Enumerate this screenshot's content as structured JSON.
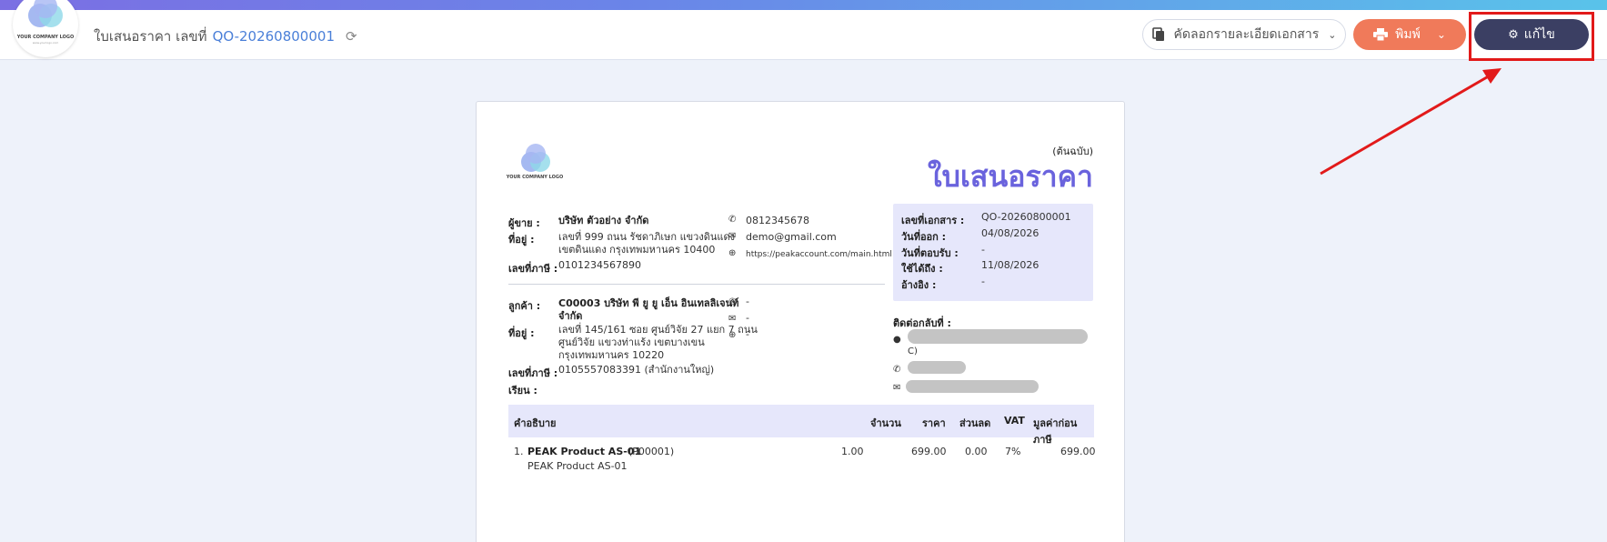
{
  "header": {
    "logo_text": "YOUR COMPANY LOGO",
    "logo_sub": "www.yourlogo.com",
    "doc_type": "ใบเสนอราคา เลขที่",
    "doc_number": "QO-20260800001",
    "copy_button": "คัดลอกรายละเอียดเอกสาร",
    "print_button": "พิมพ์",
    "edit_button": "แก้ไข"
  },
  "document": {
    "logo_text": "YOUR COMPANY LOGO",
    "original_label": "(ต้นฉบับ)",
    "title": "ใบเสนอราคา",
    "seller": {
      "seller_label": "ผู้ขาย :",
      "seller_name": "บริษัท ตัวอย่าง จำกัด",
      "address_label": "ที่อยู่ :",
      "address_line1": "เลขที่ 999 ถนน รัชดาภิเษก แขวงดินแดง",
      "address_line2": "เขตดินแดง กรุงเทพมหานคร 10400",
      "tax_label": "เลขที่ภาษี :",
      "tax_id": "0101234567890",
      "phone": "0812345678",
      "email": "demo@gmail.com",
      "website": "https://peakaccount.com/main.html"
    },
    "customer": {
      "customer_label": "ลูกค้า :",
      "customer_line1": "C00003 บริษัท พี ยู ยู เอ็น อินเทลลิเจนท์",
      "customer_line2": "จำกัด",
      "address_label": "ที่อยู่ :",
      "address_line1": "เลขที่ 145/161 ซอย ศูนย์วิจัย 27 แยก 7 ถนน",
      "address_line2": "ศูนย์วิจัย แขวงท่าแร้ง เขตบางเขน",
      "address_line3": "กรุงเทพมหานคร 10220",
      "tax_label": "เลขที่ภาษี :",
      "tax_id": "0105557083391 (สำนักงานใหญ่)",
      "attn_label": "เรียน :",
      "phone": "-",
      "email": "-",
      "website": "-"
    },
    "info": {
      "doc_no_label": "เลขที่เอกสาร :",
      "doc_no": "QO-20260800001",
      "issue_label": "วันที่ออก :",
      "issue_date": "04/08/2026",
      "reply_label": "วันที่ตอบรับ :",
      "reply_date": "-",
      "valid_label": "ใช้ได้ถึง :",
      "valid_date": "11/08/2026",
      "ref_label": "อ้างอิง :",
      "ref": "-"
    },
    "contact": {
      "label": "ติดต่อกลับที่ :",
      "name_suffix": "C)"
    },
    "table": {
      "headers": [
        "คำอธิบาย",
        "จำนวน",
        "ราคา",
        "ส่วนลด",
        "VAT",
        "มูลค่าก่อนภาษี"
      ],
      "rows": [
        {
          "no": "1.",
          "name": "PEAK Product AS-01",
          "code": "(P00001)",
          "desc": "PEAK Product AS-01",
          "qty": "1.00",
          "price": "699.00",
          "discount": "0.00",
          "vat": "7%",
          "amount": "699.00"
        }
      ]
    }
  },
  "colors": {
    "accent": "#6a63dd",
    "print_button": "#f07a5a",
    "edit_button": "#3b3f63",
    "highlight": "#e21a1a"
  }
}
